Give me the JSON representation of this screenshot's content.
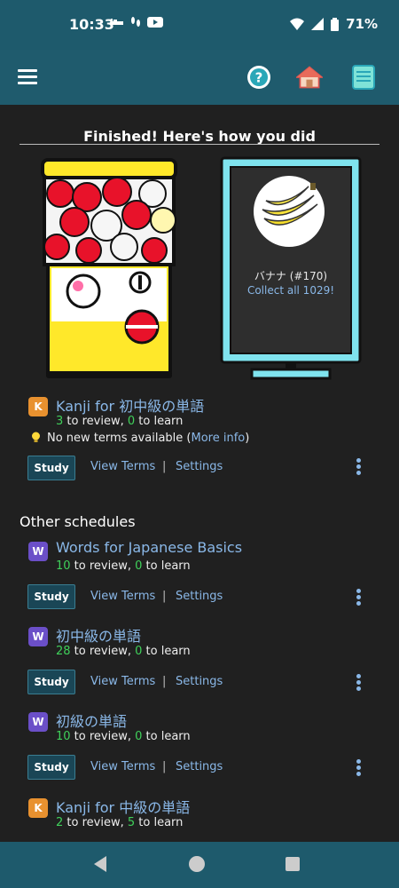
{
  "status": {
    "time": "10:33",
    "battery": "71%",
    "icons": [
      "bed-icon",
      "steps-icon",
      "youtube-icon",
      "wifi-icon",
      "signal-icon",
      "battery-icon"
    ]
  },
  "appbar": {
    "icons": [
      "menu-icon",
      "help-icon",
      "home-icon",
      "book-icon"
    ]
  },
  "finished": {
    "title": "Finished! Here's how you did",
    "prize_name": "バナナ (#170)",
    "collect": "Collect all 1029!"
  },
  "current": {
    "badge": "K",
    "title": "Kanji for 初中級の単語",
    "review_count": "3",
    "review_text": " to review, ",
    "learn_count": "0",
    "learn_text": " to learn",
    "tip_text": "No new terms available (",
    "tip_link": "More info",
    "tip_close": ")"
  },
  "actions": {
    "study": "Study",
    "view_terms": "View Terms",
    "separator": "|",
    "settings": "Settings"
  },
  "other_heading": "Other schedules",
  "others": [
    {
      "badge": "W",
      "title": "Words for Japanese Basics",
      "review_count": "10",
      "review_text": " to review, ",
      "learn_count": "0",
      "learn_text": " to learn"
    },
    {
      "badge": "W",
      "title": "初中級の単語",
      "review_count": "28",
      "review_text": " to review, ",
      "learn_count": "0",
      "learn_text": " to learn"
    },
    {
      "badge": "W",
      "title": "初級の単語",
      "review_count": "10",
      "review_text": " to review, ",
      "learn_count": "0",
      "learn_text": " to learn"
    },
    {
      "badge": "K",
      "title": "Kanji for 中級の単語",
      "review_count": "2",
      "review_text": " to review, ",
      "learn_count": "5",
      "learn_text": " to learn"
    }
  ],
  "colors": {
    "appbar": "#1f5b6d",
    "background": "#202020",
    "link": "#8ab8e8",
    "count_green": "#3fd05a",
    "badge_kanji": "#e8912f",
    "badge_words": "#6b4fc8"
  }
}
